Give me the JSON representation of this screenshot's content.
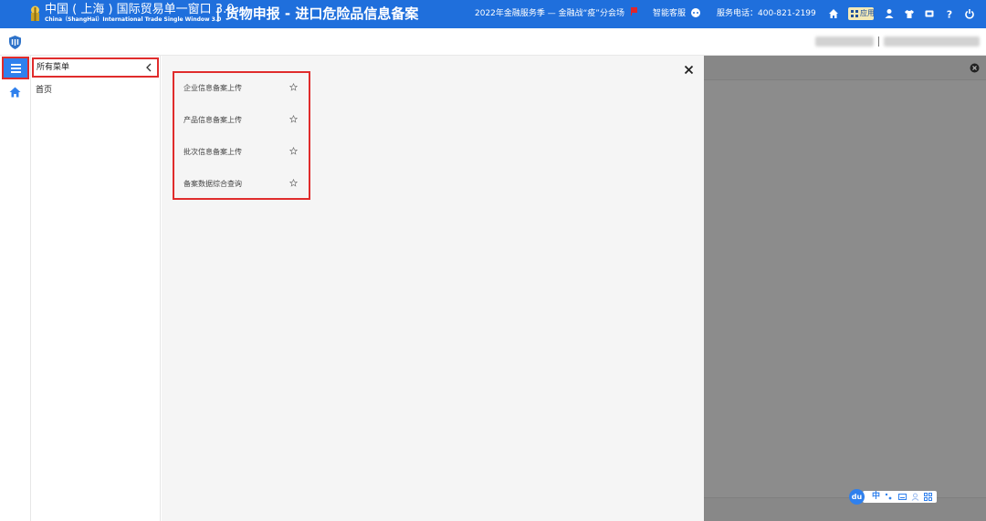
{
  "header": {
    "brand_cn": "中国 ( 上海 ) 国际贸易单一窗口 3.0",
    "brand_en": "China（ShangHai）International  Trade Single  Window  3.0",
    "system_title": "| 货物申报 - 进口危险品信息备案",
    "notice": "2022年金融服务季 — 金融战“疫”分会场",
    "smart_service": "智能客服",
    "hotline": "服务电话：400-821-2199",
    "app_label": "应用",
    "icons": [
      "home-icon",
      "apps-icon",
      "user-icon",
      "shirt-icon",
      "message-icon",
      "help-icon",
      "power-icon"
    ]
  },
  "sidebar": {
    "menu_title": "所有菜单",
    "home_label": "首页"
  },
  "submenu": {
    "items": [
      {
        "label": "企业信息备案上传"
      },
      {
        "label": "产品信息备案上传"
      },
      {
        "label": "批次信息备案上传"
      },
      {
        "label": "备案数据综合查询"
      }
    ]
  },
  "ime": {
    "logo": "du",
    "mode": "中"
  },
  "colors": {
    "header_blue": "#1f6fdc",
    "highlight_red": "#e02c2c",
    "menu_button_blue": "#2f80ed",
    "overlay_gray": "#8c8c8c"
  }
}
